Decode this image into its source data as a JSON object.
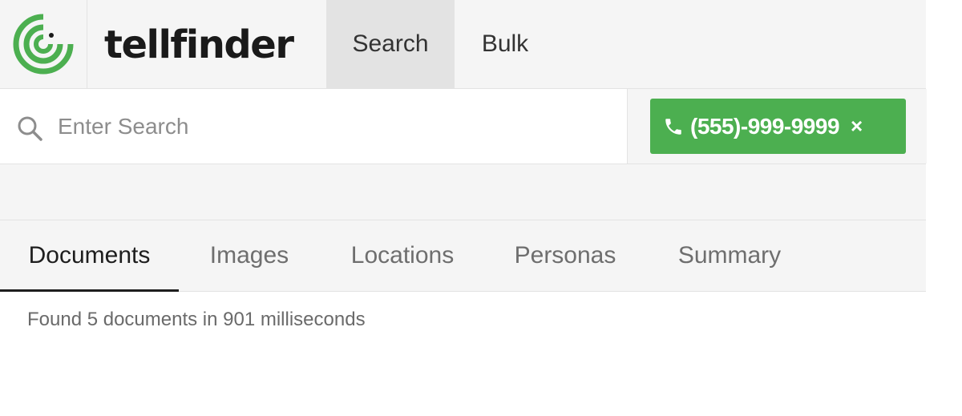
{
  "app": {
    "brand": "tellfinder",
    "brand_color": "#4caf50"
  },
  "nav": {
    "tabs": [
      {
        "label": "Search",
        "active": true
      },
      {
        "label": "Bulk",
        "active": false
      }
    ]
  },
  "search": {
    "placeholder": "Enter Search",
    "value": ""
  },
  "filter_chip": {
    "icon": "phone-icon",
    "label": "(555)-999-9999",
    "close": "×"
  },
  "result_tabs": [
    {
      "label": "Documents",
      "active": true
    },
    {
      "label": "Images",
      "active": false
    },
    {
      "label": "Locations",
      "active": false
    },
    {
      "label": "Personas",
      "active": false
    },
    {
      "label": "Summary",
      "active": false
    }
  ],
  "status": {
    "text": "Found 5 documents in 901 milliseconds"
  }
}
